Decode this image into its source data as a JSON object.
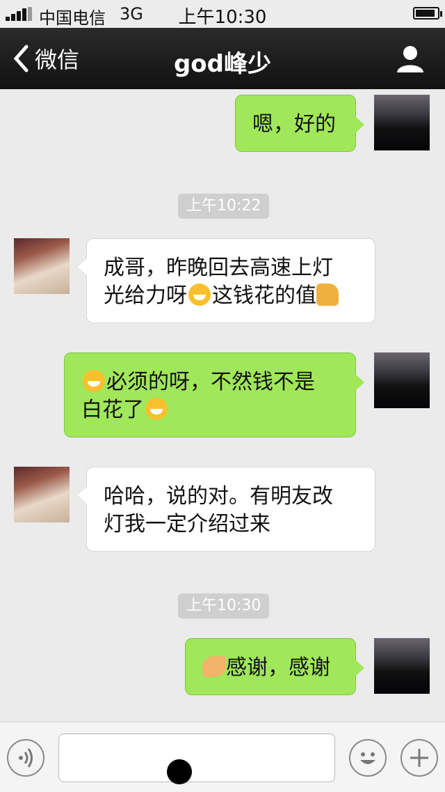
{
  "status_bar": {
    "carrier": "中国电信",
    "network": "3G",
    "time": "上午10:30",
    "battery_level": 0.9
  },
  "nav": {
    "back_label": "微信",
    "title": "god峰少"
  },
  "messages": [
    {
      "side": "sent",
      "text": "嗯，好的"
    },
    {
      "timestamp": "上午10:22"
    },
    {
      "side": "received",
      "line1a": "成哥，昨晚回去高速上灯",
      "line2a": "光给力呀",
      "line2b": "这钱花的值"
    },
    {
      "side": "sent",
      "line1a": "必须的呀，不然钱不是",
      "line2a": "白花了"
    },
    {
      "side": "received",
      "line1": "哈哈，说的对。有明友改",
      "line2": "灯我一定介绍过来"
    },
    {
      "timestamp": "上午10:30"
    },
    {
      "side": "sent",
      "text": "感谢，感谢"
    }
  ],
  "icons": {
    "back": "chevron-left-icon",
    "profile": "person-icon",
    "voice": "voice-icon",
    "emoji": "smiley-icon",
    "more": "plus-icon"
  }
}
